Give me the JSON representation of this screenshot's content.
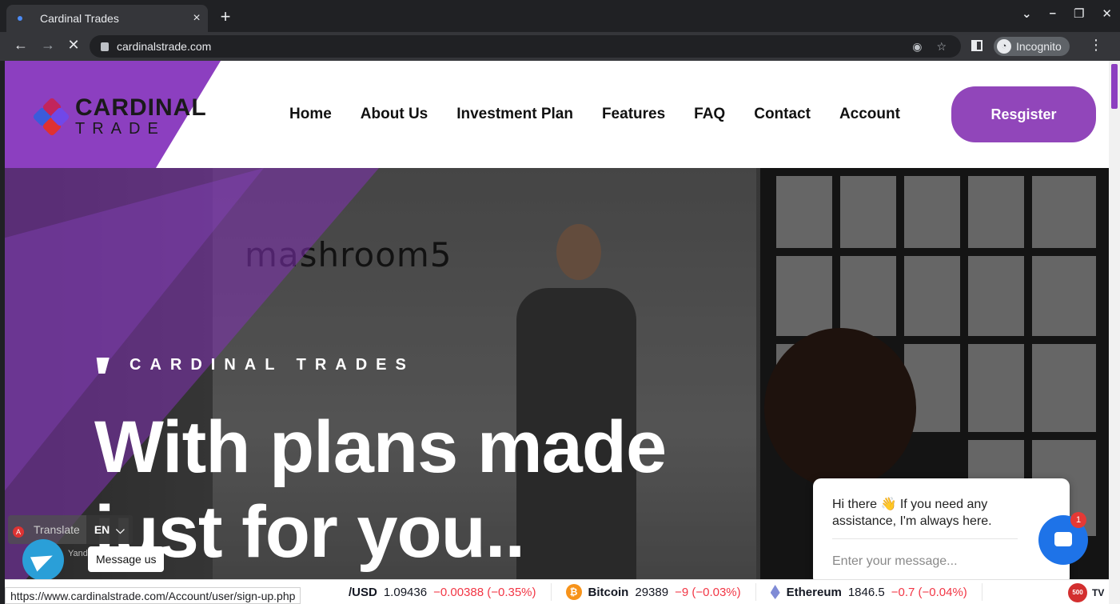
{
  "browser": {
    "tab_title": "Cardinal Trades",
    "tab_close": "×",
    "new_tab": "+",
    "url": "cardinalstrade.com",
    "incognito_label": "Incognito",
    "status_url": "https://www.cardinalstrade.com/Account/user/sign-up.php"
  },
  "logo": {
    "line1": "CARDINAL",
    "line2": "TRADE"
  },
  "nav": {
    "items": [
      "Home",
      "About Us",
      "Investment Plan",
      "Features",
      "FAQ",
      "Contact",
      "Account"
    ],
    "register_label": "Resgister"
  },
  "hero": {
    "wall_text": "mashroom5",
    "eyebrow": "CARDINAL TRADES",
    "headline_line1": "With plans made",
    "headline_line2": "just for you.."
  },
  "chat": {
    "greeting": "Hi there 👋 If you need any assistance, I'm always here.",
    "input_placeholder": "Enter your message...",
    "badge_count": "1"
  },
  "translate": {
    "label": "Translate",
    "lang": "EN",
    "provider": "Yand"
  },
  "message_us": "Message us",
  "ticker": [
    {
      "name": "/USD",
      "price": "1.09436",
      "change": "−0.00388 (−0.35%)"
    },
    {
      "name": "Bitcoin",
      "price": "29389",
      "change": "−9 (−0.03%)"
    },
    {
      "name": "Ethereum",
      "price": "1846.5",
      "change": "−0.7 (−0.04%)"
    }
  ],
  "ticker_extra": {
    "badge": "500",
    "tv_logo": "TV"
  },
  "colors": {
    "brand_purple": "#8c3fc0",
    "register_purple": "#9146ba",
    "negative": "#f23645",
    "chat_blue": "#1e73e8"
  }
}
